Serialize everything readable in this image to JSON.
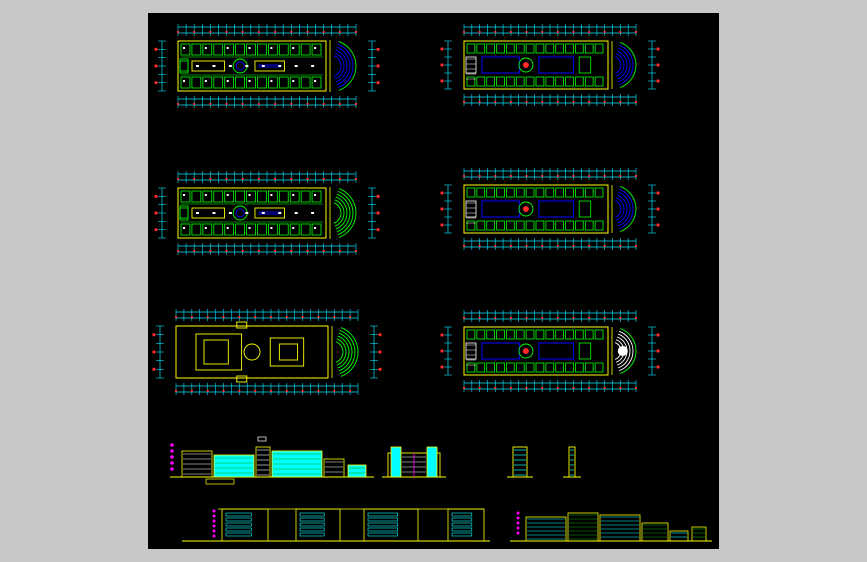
{
  "colors": {
    "page_bg": "#c8c8c8",
    "sheet_bg": "#000000",
    "dimension": "#00e5ff",
    "dimension_marker": "#ff2a2a",
    "wall": "#ffff00",
    "room_fill": "#00ff00",
    "detail": "#ffffff",
    "stair": "#0000ff",
    "outline": "#ffff00",
    "elevation_body": "#00ffff",
    "elevation_glass": "#00aa00",
    "elevation_accent": "#ff00ff"
  },
  "drawings": {
    "floor_plans": [
      {
        "id": "plan-left-1",
        "kind": "detailed-plan",
        "end": "fan-blue"
      },
      {
        "id": "plan-left-2",
        "kind": "detailed-plan",
        "end": "arc-green"
      },
      {
        "id": "plan-left-3",
        "kind": "outline-plan",
        "end": "fan-outline"
      },
      {
        "id": "plan-right-1",
        "kind": "upper-plan",
        "end": "fan-blue"
      },
      {
        "id": "plan-right-2",
        "kind": "upper-plan",
        "end": "fan-blue"
      },
      {
        "id": "plan-right-3",
        "kind": "upper-plan",
        "end": "fan-white"
      }
    ],
    "elevations": [
      {
        "id": "elevation-main",
        "kind": "long-elevation"
      },
      {
        "id": "elevation-mid",
        "kind": "short-elevation"
      },
      {
        "id": "elevation-side-1",
        "kind": "narrow-elevation"
      },
      {
        "id": "elevation-side-2",
        "kind": "narrow-elevation"
      },
      {
        "id": "section-left",
        "kind": "section"
      },
      {
        "id": "section-right",
        "kind": "section"
      }
    ]
  }
}
